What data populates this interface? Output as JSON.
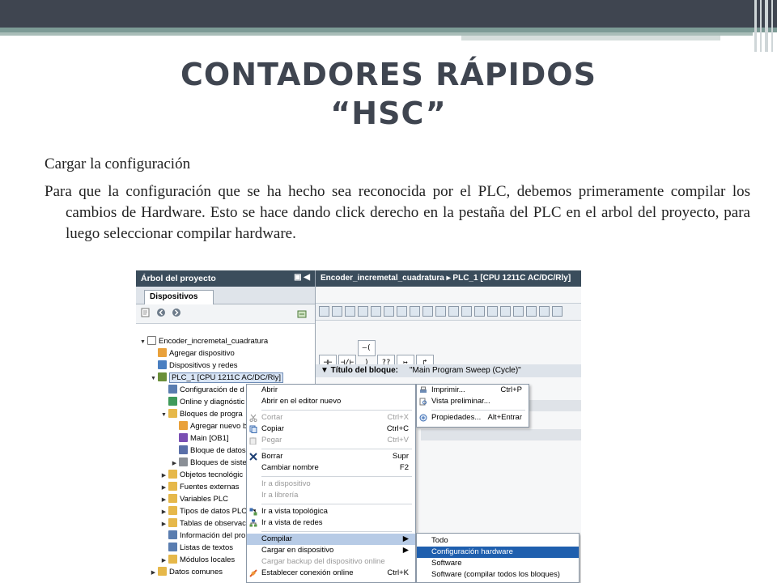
{
  "slide": {
    "title_line1": "CONTADORES RÁPIDOS",
    "title_line2": "“HSC”",
    "subtitle": "Cargar la configuración",
    "paragraph": "Para que la configuración que se ha hecho sea reconocida por el PLC, debemos primeramente compilar los cambios de Hardware. Esto se hace dando click derecho en la pestaña del PLC en el arbol del proyecto, para luego seleccionar compilar hardware."
  },
  "tree": {
    "header": "Árbol del proyecto",
    "header_buttons": "▣ ◀",
    "tab": "Dispositivos",
    "rows": [
      {
        "label": "Encoder_incremetal_cuadratura",
        "arrow": "▼",
        "color": "#ffffff"
      },
      {
        "label": "Agregar dispositivo",
        "arrow": "",
        "color": "#e9a13b"
      },
      {
        "label": "Dispositivos y redes",
        "arrow": "",
        "color": "#4a7fc1"
      },
      {
        "label": "PLC_1 [CPU 1211C AC/DC/Rly]",
        "arrow": "▼",
        "color": "#6a8f3a"
      },
      {
        "label": "Configuración de d",
        "arrow": "",
        "color": "#5a7db0"
      },
      {
        "label": "Online y diagnóstic",
        "arrow": "",
        "color": "#3f9a5a"
      },
      {
        "label": "Bloques de progra",
        "arrow": "▼",
        "color": "#e6b84a"
      },
      {
        "label": "Agregar nuevo b",
        "arrow": "",
        "color": "#e9a13b"
      },
      {
        "label": "Main [OB1]",
        "arrow": "",
        "color": "#7a4fb3"
      },
      {
        "label": "Bloque de datos",
        "arrow": "",
        "color": "#5a6fa8"
      },
      {
        "label": "Bloques de siste",
        "arrow": "▶",
        "color": "#8a8f96"
      },
      {
        "label": "Objetos tecnológic",
        "arrow": "▶",
        "color": "#e6b84a"
      },
      {
        "label": "Fuentes externas",
        "arrow": "▶",
        "color": "#e6b84a"
      },
      {
        "label": "Variables PLC",
        "arrow": "▶",
        "color": "#e6b84a"
      },
      {
        "label": "Tipos de datos PLC",
        "arrow": "▶",
        "color": "#e6b84a"
      },
      {
        "label": "Tablas de observac",
        "arrow": "▶",
        "color": "#e6b84a"
      },
      {
        "label": "Información del pro",
        "arrow": "",
        "color": "#5a7db0"
      },
      {
        "label": "Listas de textos",
        "arrow": "",
        "color": "#5a7db0"
      },
      {
        "label": "Módulos locales",
        "arrow": "▶",
        "color": "#e6b84a"
      },
      {
        "label": "Datos comunes",
        "arrow": "▶",
        "color": "#e6b84a"
      }
    ]
  },
  "editor": {
    "header": "Encoder_incremetal_cuadratura  ▸  PLC_1 [CPU 1211C AC/DC/Rly]",
    "ladder_buttons": [
      "⊣⊢",
      "⊣/⊢",
      "–( )",
      "??",
      "↦",
      "↱"
    ],
    "block_title_label": "▼  Título del bloque:",
    "block_title_value": "\"Main Program Sweep (Cycle)\""
  },
  "context_menu": {
    "items": [
      {
        "label": "Abrir",
        "shortcut": "",
        "state": ""
      },
      {
        "label": "Abrir en el editor nuevo",
        "shortcut": "",
        "state": ""
      },
      {
        "label": "Cortar",
        "shortcut": "Ctrl+X",
        "state": "dis"
      },
      {
        "label": "Copiar",
        "shortcut": "Ctrl+C",
        "state": ""
      },
      {
        "label": "Pegar",
        "shortcut": "Ctrl+V",
        "state": "dis"
      },
      {
        "label": "Borrar",
        "shortcut": "Supr",
        "state": ""
      },
      {
        "label": "Cambiar nombre",
        "shortcut": "F2",
        "state": ""
      },
      {
        "label": "Ir a dispositivo",
        "shortcut": "",
        "state": "dis"
      },
      {
        "label": "Ir a librería",
        "shortcut": "",
        "state": "dis"
      },
      {
        "label": "Ir a vista topológica",
        "shortcut": "",
        "state": ""
      },
      {
        "label": "Ir a vista de redes",
        "shortcut": "",
        "state": ""
      },
      {
        "label": "Compilar",
        "shortcut": "▶",
        "state": "hl"
      },
      {
        "label": "Cargar en dispositivo",
        "shortcut": "▶",
        "state": ""
      },
      {
        "label": "Cargar backup del dispositivo online",
        "shortcut": "",
        "state": "dis"
      },
      {
        "label": "Establecer conexión online",
        "shortcut": "Ctrl+K",
        "state": ""
      }
    ]
  },
  "print_menu": {
    "items": [
      {
        "label": "Imprimir...",
        "shortcut": "Ctrl+P"
      },
      {
        "label": "Vista preliminar...",
        "shortcut": ""
      },
      {
        "label": "Propiedades...",
        "shortcut": "Alt+Entrar"
      }
    ]
  },
  "compile_submenu": {
    "items": [
      {
        "label": "Todo",
        "state": ""
      },
      {
        "label": "Configuración hardware",
        "state": "hl2"
      },
      {
        "label": "Software",
        "state": ""
      },
      {
        "label": "Software (compilar todos los bloques)",
        "state": ""
      }
    ]
  },
  "colors": {
    "slide_dark": "#3f4550",
    "panel_header": "#3b4d5c",
    "menu_highlight": "#b7cbe6",
    "submenu_selected": "#1f5fae"
  }
}
